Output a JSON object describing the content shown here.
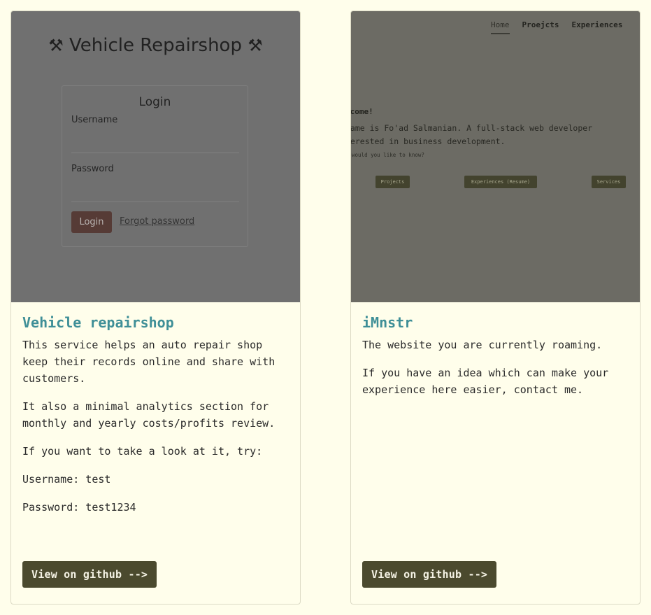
{
  "projects": [
    {
      "title": "Vehicle repairshop",
      "paragraphs": [
        "This service helps an auto repair shop keep their records online and share with customers.",
        "It also a minimal analytics section for monthly and yearly costs/profits review.",
        "If you want to take a look at it, try:",
        "Username: test",
        "Password: test1234"
      ],
      "button_label": "View on github -->",
      "preview": {
        "app_title": "Vehicle Repairshop",
        "title_icon": "⚒",
        "login_heading": "Login",
        "username_label": "Username",
        "password_label": "Password",
        "login_button": "Login",
        "forgot_link": "Forgot password"
      }
    },
    {
      "title": "iMnstr",
      "paragraphs": [
        "The website you are currently roaming.",
        "If you have an idea which can make your experience here easier, contact me."
      ],
      "button_label": "View on github -->",
      "preview": {
        "nav": [
          "Home",
          "Proejcts",
          "Experiences"
        ],
        "welcome": "lcome!",
        "intro_line1": "name is Fo'ad Salmanian. A full-stack web developer",
        "intro_line2": "terested in business development.",
        "question": "t would you like to know?",
        "buttons": [
          "Projects",
          "Experiences (Resume)",
          "Services"
        ]
      }
    }
  ],
  "colors": {
    "background": "#fffeeb",
    "title": "#3f8f97",
    "button": "#4b4a2e"
  }
}
